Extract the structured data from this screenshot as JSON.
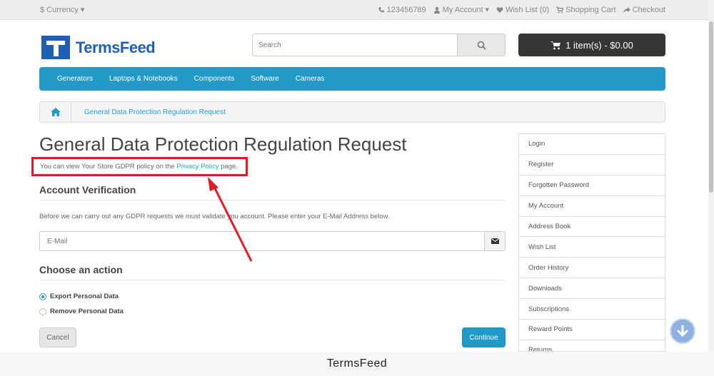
{
  "topbar": {
    "currency_label": "$ Currency",
    "phone": "123456789",
    "my_account": "My Account",
    "wishlist": "Wish List (0)",
    "shopping_cart": "Shopping Cart",
    "checkout": "Checkout"
  },
  "header": {
    "logo_text": "TermsFeed",
    "search_placeholder": "Search",
    "cart_label": "1 item(s) - $0.00"
  },
  "nav": {
    "items": [
      "Generators",
      "Laptops & Notebooks",
      "Components",
      "Software",
      "Cameras"
    ]
  },
  "breadcrumb": {
    "current": "General Data Protection Regulation Request"
  },
  "main": {
    "title": "General Data Protection Regulation Request",
    "intro_prefix": "You can view Your Store GDPR policy on the ",
    "intro_link": "Privacy Policy",
    "intro_suffix": " page.",
    "account_verification_title": "Account Verification",
    "verify_text": "Before we can carry out any GDPR requests we must validate you account. Please enter your E-Mail Address below.",
    "email_placeholder": "E-Mail",
    "choose_action_title": "Choose an action",
    "options": [
      {
        "label": "Export Personal Data",
        "checked": true
      },
      {
        "label": "Remove Personal Data",
        "checked": false
      }
    ],
    "cancel_label": "Cancel",
    "continue_label": "Continue"
  },
  "sidebar": {
    "items": [
      "Login",
      "Register",
      "Forgotten Password",
      "My Account",
      "Address Book",
      "Wish List",
      "Order History",
      "Downloads",
      "Subscriptions",
      "Reward Points",
      "Returns"
    ]
  },
  "caption": "TermsFeed",
  "colors": {
    "accent": "#229ac8",
    "brand": "#1f5fb8",
    "annotation": "#e01b24"
  }
}
